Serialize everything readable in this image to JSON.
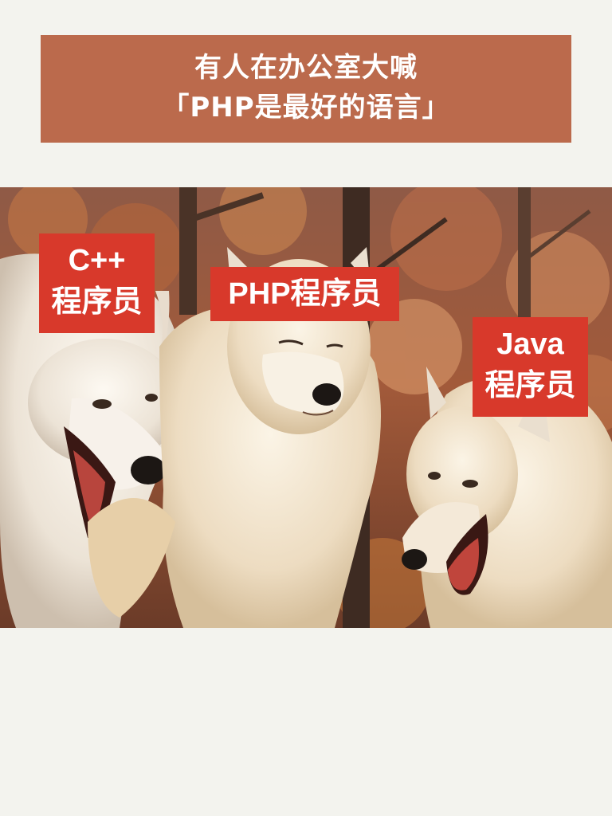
{
  "title_banner": {
    "line1": "有人在办公室大喊",
    "line2": "「PHP是最好的语言」",
    "background_color": "#bb6a4c"
  },
  "photo": {
    "subject": "three white wolves in an autumn forest"
  },
  "labels": {
    "cpp": {
      "line1": "C++",
      "line2": "程序员"
    },
    "php": {
      "text": "PHP程序员"
    },
    "java": {
      "line1": "Java",
      "line2": "程序员"
    },
    "background_color": "#d8392b"
  }
}
